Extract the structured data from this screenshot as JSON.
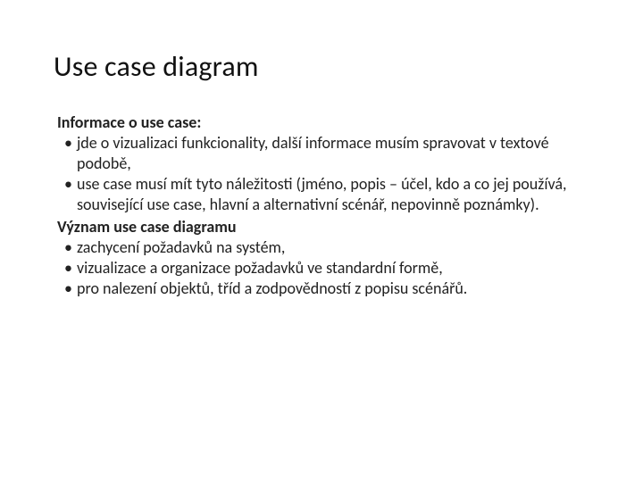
{
  "title": "Use case diagram",
  "section1": {
    "heading": "Informace o use case:",
    "items": [
      "jde o vizualizaci funkcionality, další informace musím spravovat v textové podobě,",
      "use case musí mít tyto náležitosti (jméno, popis – účel, kdo a co jej používá, související use case,  hlavní a alternativní scénář, nepovinně poznámky)."
    ]
  },
  "section2": {
    "heading": "Význam use case diagramu",
    "items": [
      "zachycení požadavků na systém,",
      "vizualizace a organizace požadavků ve standardní formě,",
      "pro nalezení objektů, tříd a zodpovědností z popisu scénářů."
    ]
  }
}
